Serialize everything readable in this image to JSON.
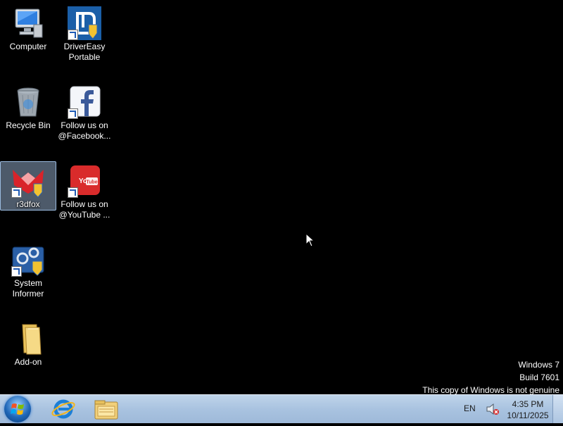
{
  "desktop": {
    "icons": [
      {
        "label": "Computer",
        "icon": "computer-icon"
      },
      {
        "label": "DriverEasy\nPortable",
        "icon": "drivereasy-icon"
      },
      {
        "label": "Recycle Bin",
        "icon": "recycle-bin-icon"
      },
      {
        "label": "Follow us on\n@Facebook...",
        "icon": "facebook-icon"
      },
      {
        "label": "r3dfox",
        "icon": "r3dfox-icon"
      },
      {
        "label": "Follow us on\n@YouTube ...",
        "icon": "youtube-icon"
      },
      {
        "label": "System\nInformer",
        "icon": "system-informer-icon"
      },
      {
        "label": "Add-on",
        "icon": "folder-icon"
      }
    ]
  },
  "watermark": {
    "line1": "Windows 7",
    "line2": "Build 7601",
    "line3": "This copy of Windows is not genuine"
  },
  "taskbar": {
    "language": "EN",
    "time": "4:35 PM",
    "date": "10/11/2025"
  }
}
